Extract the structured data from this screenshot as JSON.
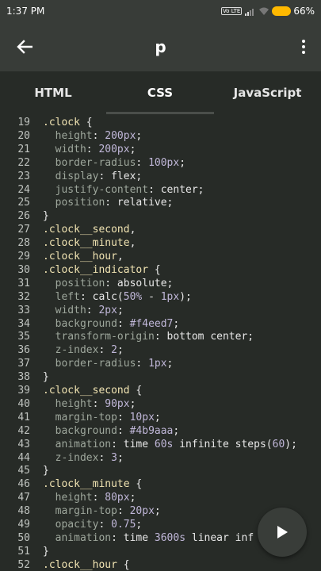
{
  "status": {
    "time": "1:37 PM",
    "network": "Vo LTE",
    "battery": "66%"
  },
  "appbar": {
    "title": "p"
  },
  "tabs": [
    {
      "label": "HTML"
    },
    {
      "label": "CSS",
      "active": true
    },
    {
      "label": "JavaScript"
    }
  ],
  "colors": {
    "background": "#272b27",
    "bar": "#383c38",
    "selector": "#f0e3b2",
    "property": "#9ea79c",
    "value": "#c0b7d8",
    "battery": "#ffb900"
  },
  "code": [
    {
      "n": "19",
      "s": [
        [
          "sel",
          ".clock"
        ],
        [
          "plain",
          " {"
        ]
      ]
    },
    {
      "n": "20",
      "s": [
        [
          "plain",
          "  "
        ],
        [
          "prop",
          "height"
        ],
        [
          "plain",
          ": "
        ],
        [
          "val",
          "200px"
        ],
        [
          "plain",
          ";"
        ]
      ]
    },
    {
      "n": "21",
      "s": [
        [
          "plain",
          "  "
        ],
        [
          "prop",
          "width"
        ],
        [
          "plain",
          ": "
        ],
        [
          "val",
          "200px"
        ],
        [
          "plain",
          ";"
        ]
      ]
    },
    {
      "n": "22",
      "s": [
        [
          "plain",
          "  "
        ],
        [
          "prop",
          "border-radius"
        ],
        [
          "plain",
          ": "
        ],
        [
          "val",
          "100px"
        ],
        [
          "plain",
          ";"
        ]
      ]
    },
    {
      "n": "23",
      "s": [
        [
          "plain",
          "  "
        ],
        [
          "prop",
          "display"
        ],
        [
          "plain",
          ": flex;"
        ]
      ]
    },
    {
      "n": "24",
      "s": [
        [
          "plain",
          "  "
        ],
        [
          "prop",
          "justify-content"
        ],
        [
          "plain",
          ": center;"
        ]
      ]
    },
    {
      "n": "25",
      "s": [
        [
          "plain",
          "  "
        ],
        [
          "prop",
          "position"
        ],
        [
          "plain",
          ": relative;"
        ]
      ]
    },
    {
      "n": "26",
      "s": [
        [
          "plain",
          "}"
        ]
      ]
    },
    {
      "n": "27",
      "s": [
        [
          "sel",
          ".clock__second"
        ],
        [
          "plain",
          ","
        ]
      ]
    },
    {
      "n": "28",
      "s": [
        [
          "sel",
          ".clock__minute"
        ],
        [
          "plain",
          ","
        ]
      ]
    },
    {
      "n": "29",
      "s": [
        [
          "sel",
          ".clock__hour"
        ],
        [
          "plain",
          ","
        ]
      ]
    },
    {
      "n": "30",
      "s": [
        [
          "sel",
          ".clock__indicator"
        ],
        [
          "plain",
          " {"
        ]
      ]
    },
    {
      "n": "31",
      "s": [
        [
          "plain",
          "  "
        ],
        [
          "prop",
          "position"
        ],
        [
          "plain",
          ": absolute;"
        ]
      ]
    },
    {
      "n": "32",
      "s": [
        [
          "plain",
          "  "
        ],
        [
          "prop",
          "left"
        ],
        [
          "plain",
          ": calc("
        ],
        [
          "val",
          "50%"
        ],
        [
          "plain",
          " - "
        ],
        [
          "val",
          "1px"
        ],
        [
          "plain",
          ");"
        ]
      ]
    },
    {
      "n": "33",
      "s": [
        [
          "plain",
          "  "
        ],
        [
          "prop",
          "width"
        ],
        [
          "plain",
          ": "
        ],
        [
          "val",
          "2px"
        ],
        [
          "plain",
          ";"
        ]
      ]
    },
    {
      "n": "34",
      "s": [
        [
          "plain",
          "  "
        ],
        [
          "prop",
          "background"
        ],
        [
          "plain",
          ": "
        ],
        [
          "val",
          "#f4eed7"
        ],
        [
          "plain",
          ";"
        ]
      ]
    },
    {
      "n": "35",
      "s": [
        [
          "plain",
          "  "
        ],
        [
          "prop",
          "transform-origin"
        ],
        [
          "plain",
          ": bottom center;"
        ]
      ]
    },
    {
      "n": "36",
      "s": [
        [
          "plain",
          "  "
        ],
        [
          "prop",
          "z-index"
        ],
        [
          "plain",
          ": "
        ],
        [
          "val",
          "2"
        ],
        [
          "plain",
          ";"
        ]
      ]
    },
    {
      "n": "37",
      "s": [
        [
          "plain",
          "  "
        ],
        [
          "prop",
          "border-radius"
        ],
        [
          "plain",
          ": "
        ],
        [
          "val",
          "1px"
        ],
        [
          "plain",
          ";"
        ]
      ]
    },
    {
      "n": "38",
      "s": [
        [
          "plain",
          "}"
        ]
      ]
    },
    {
      "n": "39",
      "s": [
        [
          "sel",
          ".clock__second"
        ],
        [
          "plain",
          " {"
        ]
      ]
    },
    {
      "n": "40",
      "s": [
        [
          "plain",
          "  "
        ],
        [
          "prop",
          "height"
        ],
        [
          "plain",
          ": "
        ],
        [
          "val",
          "90px"
        ],
        [
          "plain",
          ";"
        ]
      ]
    },
    {
      "n": "41",
      "s": [
        [
          "plain",
          "  "
        ],
        [
          "prop",
          "margin-top"
        ],
        [
          "plain",
          ": "
        ],
        [
          "val",
          "10px"
        ],
        [
          "plain",
          ";"
        ]
      ]
    },
    {
      "n": "42",
      "s": [
        [
          "plain",
          "  "
        ],
        [
          "prop",
          "background"
        ],
        [
          "plain",
          ": "
        ],
        [
          "val",
          "#4b9aaa"
        ],
        [
          "plain",
          ";"
        ]
      ]
    },
    {
      "n": "43",
      "s": [
        [
          "plain",
          "  "
        ],
        [
          "prop",
          "animation"
        ],
        [
          "plain",
          ": time "
        ],
        [
          "val",
          "60s"
        ],
        [
          "plain",
          " infinite steps("
        ],
        [
          "val",
          "60"
        ],
        [
          "plain",
          ");"
        ]
      ]
    },
    {
      "n": "44",
      "s": [
        [
          "plain",
          "  "
        ],
        [
          "prop",
          "z-index"
        ],
        [
          "plain",
          ": "
        ],
        [
          "val",
          "3"
        ],
        [
          "plain",
          ";"
        ]
      ]
    },
    {
      "n": "45",
      "s": [
        [
          "plain",
          "}"
        ]
      ]
    },
    {
      "n": "46",
      "s": [
        [
          "sel",
          ".clock__minute"
        ],
        [
          "plain",
          " {"
        ]
      ]
    },
    {
      "n": "47",
      "s": [
        [
          "plain",
          "  "
        ],
        [
          "prop",
          "height"
        ],
        [
          "plain",
          ": "
        ],
        [
          "val",
          "80px"
        ],
        [
          "plain",
          ";"
        ]
      ]
    },
    {
      "n": "48",
      "s": [
        [
          "plain",
          "  "
        ],
        [
          "prop",
          "margin-top"
        ],
        [
          "plain",
          ": "
        ],
        [
          "val",
          "20px"
        ],
        [
          "plain",
          ";"
        ]
      ]
    },
    {
      "n": "49",
      "s": [
        [
          "plain",
          "  "
        ],
        [
          "prop",
          "opacity"
        ],
        [
          "plain",
          ": "
        ],
        [
          "val",
          "0.75"
        ],
        [
          "plain",
          ";"
        ]
      ]
    },
    {
      "n": "50",
      "s": [
        [
          "plain",
          "  "
        ],
        [
          "prop",
          "animation"
        ],
        [
          "plain",
          ": time "
        ],
        [
          "val",
          "3600s"
        ],
        [
          "plain",
          " linear inf"
        ]
      ]
    },
    {
      "n": "51",
      "s": [
        [
          "plain",
          "}"
        ]
      ]
    },
    {
      "n": "52",
      "s": [
        [
          "sel",
          ".clock__hour"
        ],
        [
          "plain",
          " {"
        ]
      ]
    }
  ]
}
